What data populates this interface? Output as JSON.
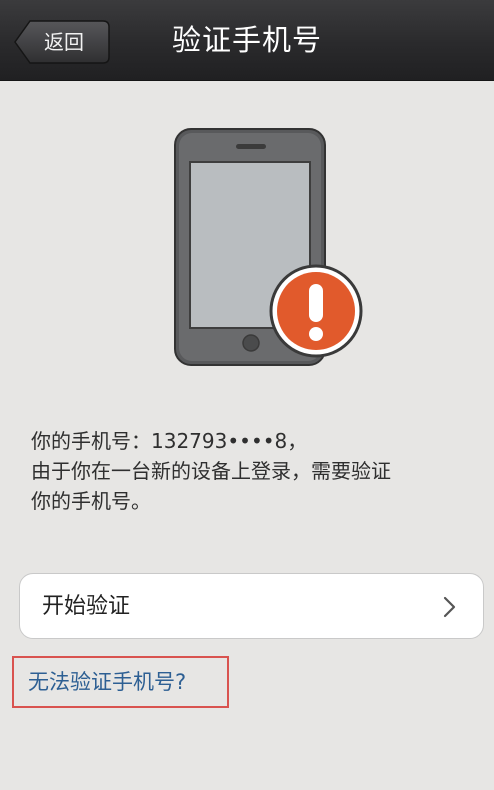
{
  "header": {
    "back_label": "返回",
    "title": "验证手机号"
  },
  "illustration": {
    "icon": "phone-warning-icon",
    "warning_color": "#e15a2c"
  },
  "info": {
    "line1": "你的手机号：132793••••8，",
    "line2": "由于你在一台新的设备上登录，需要验证",
    "line3": "你的手机号。"
  },
  "actions": {
    "start_label": "开始验证",
    "chevron_icon": "chevron-right-icon",
    "help_link": "无法验证手机号?"
  }
}
